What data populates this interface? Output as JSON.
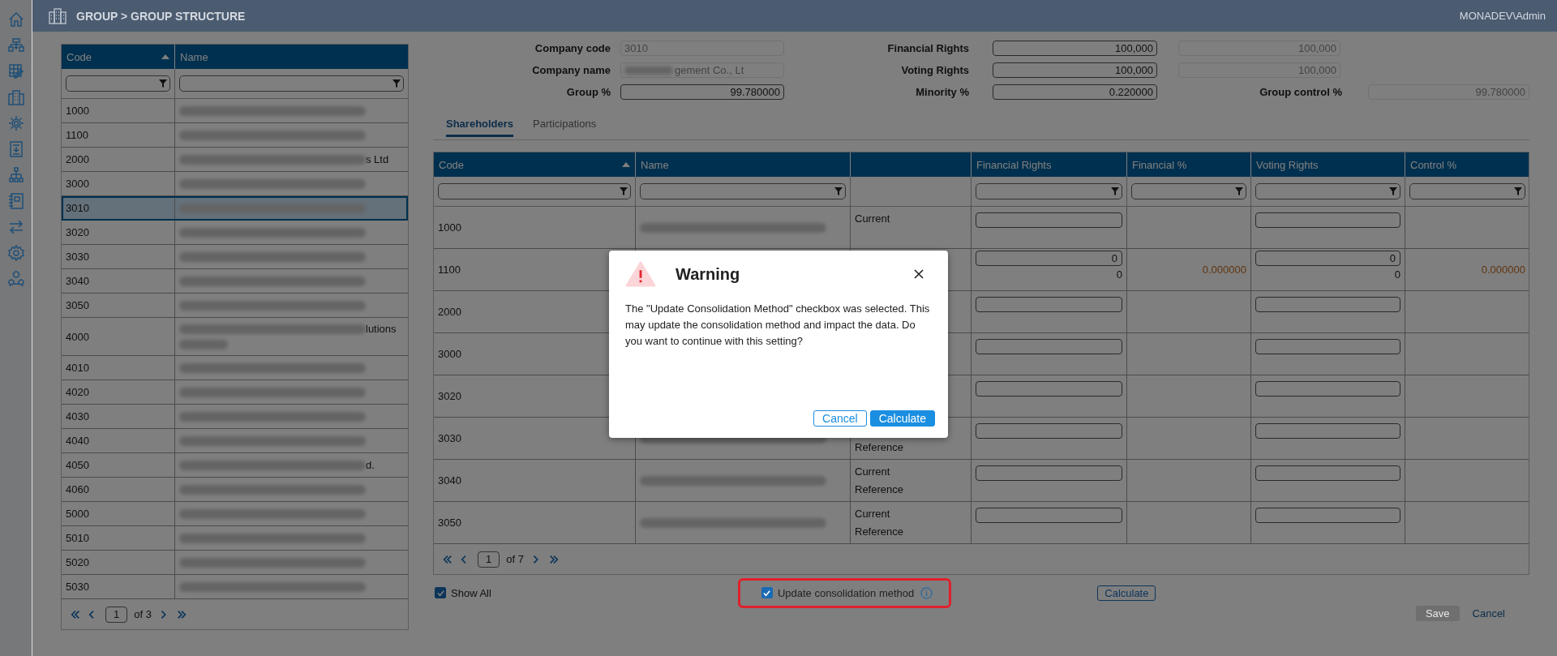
{
  "header": {
    "breadcrumb": "GROUP > GROUP STRUCTURE",
    "user": "MONADEV\\Admin"
  },
  "company_list": {
    "columns": [
      {
        "label": "Code",
        "sorted": true
      },
      {
        "label": "Name",
        "sorted": false
      }
    ],
    "rows": [
      {
        "code": "1000",
        "selected": false
      },
      {
        "code": "1100",
        "selected": false
      },
      {
        "code": "2000",
        "selected": false,
        "name_tail": "s Ltd"
      },
      {
        "code": "3000",
        "selected": false
      },
      {
        "code": "3010",
        "selected": true
      },
      {
        "code": "3020",
        "selected": false
      },
      {
        "code": "3030",
        "selected": false
      },
      {
        "code": "3040",
        "selected": false
      },
      {
        "code": "3050",
        "selected": false
      },
      {
        "code": "4000",
        "selected": false,
        "name_tail": "lutions",
        "two_line": true
      },
      {
        "code": "4010",
        "selected": false
      },
      {
        "code": "4020",
        "selected": false
      },
      {
        "code": "4030",
        "selected": false
      },
      {
        "code": "4040",
        "selected": false
      },
      {
        "code": "4050",
        "selected": false,
        "name_tail": "d."
      },
      {
        "code": "4060",
        "selected": false
      },
      {
        "code": "5000",
        "selected": false
      },
      {
        "code": "5010",
        "selected": false
      },
      {
        "code": "5020",
        "selected": false
      },
      {
        "code": "5030",
        "selected": false
      }
    ],
    "pager": {
      "page": "1",
      "of": "of 3"
    }
  },
  "form_rows": [
    [
      {
        "label": "Company code",
        "value": "3010",
        "readonly": true
      },
      {
        "label": "Financial Rights",
        "value": "100,000",
        "readonly": false
      },
      {
        "value": "100,000",
        "readonly": true
      }
    ],
    [
      {
        "label": "Company name",
        "value": "gement Co., Lt",
        "readonly": true,
        "redacted": true
      },
      {
        "label": "Voting Rights",
        "value": "100,000",
        "readonly": false
      },
      {
        "value": "100,000",
        "readonly": true
      }
    ],
    [
      {
        "label": "Group %",
        "value": "99.780000",
        "readonly": false
      },
      {
        "label": "Minority %",
        "value": "0.220000",
        "readonly": false
      },
      {
        "label": "Group control %",
        "value": "99.780000",
        "readonly": true
      }
    ]
  ],
  "tabs": [
    {
      "label": "Shareholders",
      "selected": true
    },
    {
      "label": "Participations",
      "selected": false
    }
  ],
  "shareholders": {
    "columns": [
      {
        "label": "Code",
        "sorted": true,
        "filter": true
      },
      {
        "label": "Name",
        "sorted": false,
        "filter": true
      },
      {
        "filter": false
      },
      {
        "label": "Financial Rights",
        "sorted": false,
        "filter": true
      },
      {
        "label": "Financial %",
        "sorted": false,
        "filter": true
      },
      {
        "label": "Voting Rights",
        "sorted": false,
        "filter": true
      },
      {
        "label": "Control %",
        "sorted": false,
        "filter": true
      }
    ],
    "rows": [
      {
        "code": "1000",
        "name_redacted": true,
        "reference": "Current"
      },
      {
        "code": "1100",
        "financial_rights": "0",
        "financial_rights_sub": "0",
        "financial_pct": "0.000000",
        "voting_rights": "0",
        "voting_rights_sub": "0",
        "control_pct": "0.000000"
      },
      {
        "code": "2000"
      },
      {
        "code": "3000"
      },
      {
        "code": "3020"
      },
      {
        "code": "3030",
        "name_redacted": true,
        "reference": "Reference",
        "reference_offset": true
      },
      {
        "code": "3040",
        "name_redacted": true,
        "reference": "Current Reference"
      },
      {
        "code": "3050",
        "name_redacted": true,
        "reference": "Current Reference"
      }
    ],
    "pager": {
      "page": "1",
      "of": "of 7"
    }
  },
  "footer": {
    "show_all": {
      "label": "Show All",
      "checked": true
    },
    "update_method": {
      "label": "Update consolidation method",
      "checked": true,
      "highlighted": true
    },
    "calculate": "Calculate",
    "save": {
      "label": "Save",
      "disabled": true
    },
    "cancel": "Cancel"
  },
  "dialog": {
    "title": "Warning",
    "message": "The \"Update Consolidation Method\" checkbox was selected. This may update the consolidation method and impact the data. Do you want to continue with this setting?",
    "buttons": [
      {
        "label": "Cancel",
        "kind": "secondary"
      },
      {
        "label": "Calculate",
        "kind": "primary"
      }
    ]
  }
}
